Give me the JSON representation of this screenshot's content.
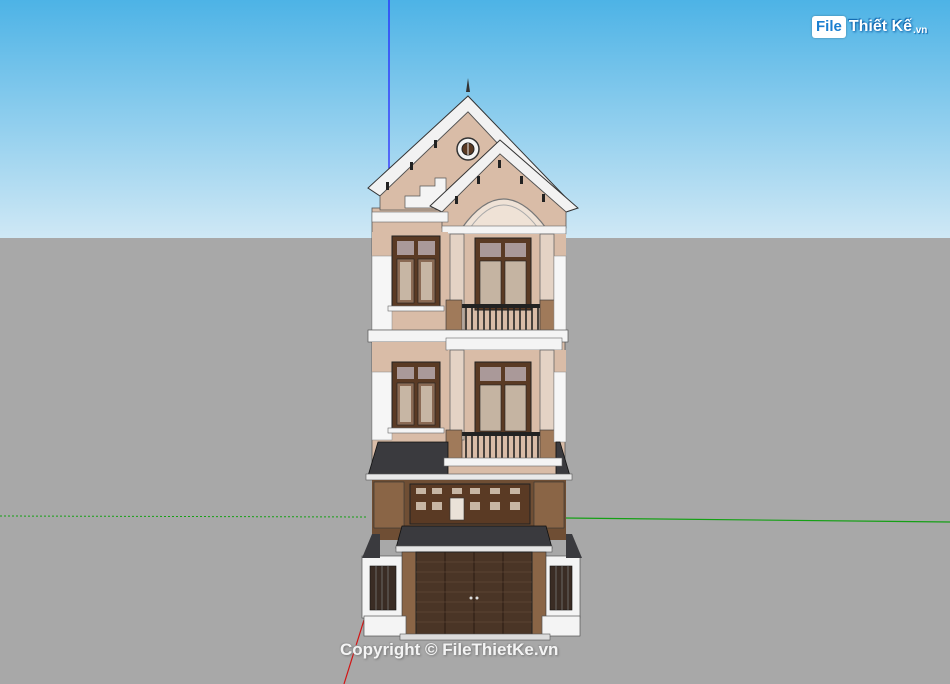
{
  "watermark": {
    "logo_box_text": "File",
    "logo_rest_text": "Thiết Kế",
    "logo_ext_text": ".vn",
    "copyright_text": "Copyright © FileThietKe.vn"
  },
  "scene": {
    "sky_color_top": "#4fb4e6",
    "sky_color_bottom": "#cbe6f4",
    "ground_color": "#a9a9a9",
    "axis_blue": "#1a1aff",
    "axis_green": "#15a015",
    "axis_red": "#d21414",
    "wall_color": "#d8bba6",
    "trim_color": "#f6f6f6",
    "door_color": "#5a3a24",
    "roof_color": "#3a3a3e"
  }
}
